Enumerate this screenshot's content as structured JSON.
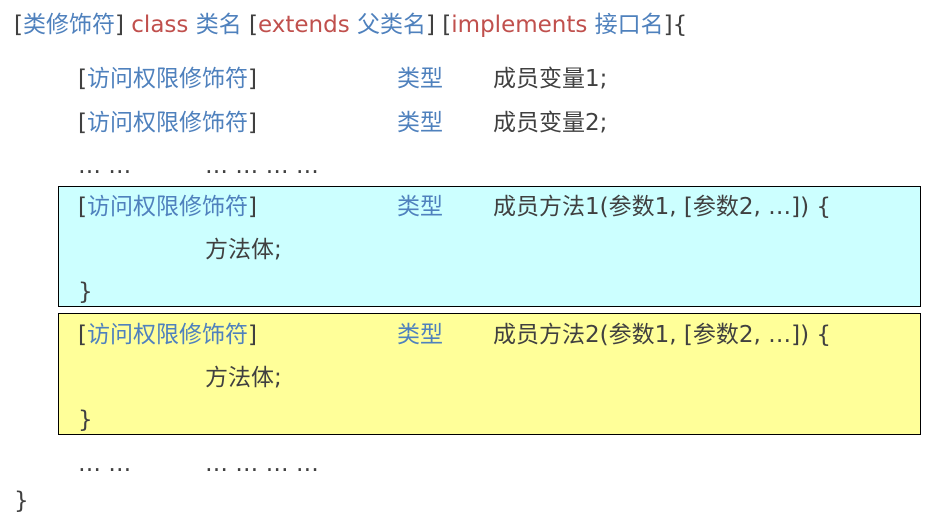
{
  "colors": {
    "blue": "#4f81bd",
    "red": "#c0504d",
    "gray": "#404040",
    "method1_bg": "#ccffff",
    "method2_bg": "#ffff99"
  },
  "header": {
    "open_bracket_1": "[",
    "class_modifier": "类修饰符",
    "close_bracket_1": "]",
    "class_keyword": "class",
    "class_name": "类名",
    "open_bracket_2": "[",
    "extends_keyword": "extends",
    "parent_class_name": "父类名",
    "close_bracket_2": "]",
    "open_bracket_3": "[",
    "implements_keyword": "implements",
    "interface_name": "接口名",
    "close_bracket_3": "]",
    "open_brace": "{"
  },
  "fields": [
    {
      "open_bracket": "[",
      "access_modifier": "访问权限修饰符",
      "close_bracket": "]",
      "type": "类型",
      "name": "成员变量1;"
    },
    {
      "open_bracket": "[",
      "access_modifier": "访问权限修饰符",
      "close_bracket": "]",
      "type": "类型",
      "name": "成员变量2;"
    }
  ],
  "ellipsis_1": {
    "left": "… …",
    "right": "… … … …"
  },
  "methods": [
    {
      "open_bracket": "[",
      "access_modifier": "访问权限修饰符",
      "close_bracket": "]",
      "type": "类型",
      "signature": "成员方法1(参数1, [参数2, …]) {",
      "body": "方法体;",
      "close_brace": "}"
    },
    {
      "open_bracket": "[",
      "access_modifier": "访问权限修饰符",
      "close_bracket": "]",
      "type": "类型",
      "signature": "成员方法2(参数1, [参数2, …]) {",
      "body": "方法体;",
      "close_brace": "}"
    }
  ],
  "ellipsis_2": {
    "left": "… …",
    "right": "… … … …"
  },
  "footer": {
    "close_brace": "}"
  }
}
